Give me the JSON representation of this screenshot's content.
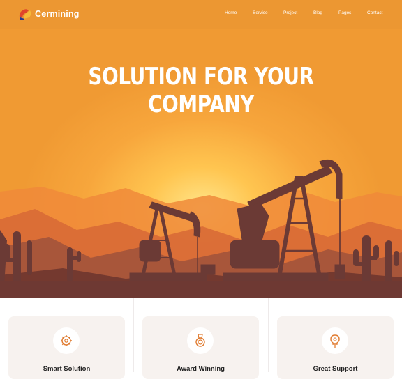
{
  "brand": {
    "name": "Cermining",
    "logo_icon": "logo-icon"
  },
  "nav": {
    "items": [
      {
        "label": "Home"
      },
      {
        "label": "Service"
      },
      {
        "label": "Project"
      },
      {
        "label": "Blog"
      },
      {
        "label": "Pages"
      },
      {
        "label": "Contact"
      }
    ]
  },
  "hero": {
    "line1": "SOLUTION FOR YOUR",
    "line2": "COMPANY"
  },
  "features": [
    {
      "title": "Smart Solution",
      "icon": "gear-brain-icon"
    },
    {
      "title": "Award Winning",
      "icon": "award-medal-icon"
    },
    {
      "title": "Great Support",
      "icon": "lightbulb-icon"
    }
  ],
  "colors": {
    "accent": "#f7a63c",
    "icon": "#e07a2e",
    "nav_text": "#ffffff",
    "card_bg": "#f7f2ef"
  }
}
